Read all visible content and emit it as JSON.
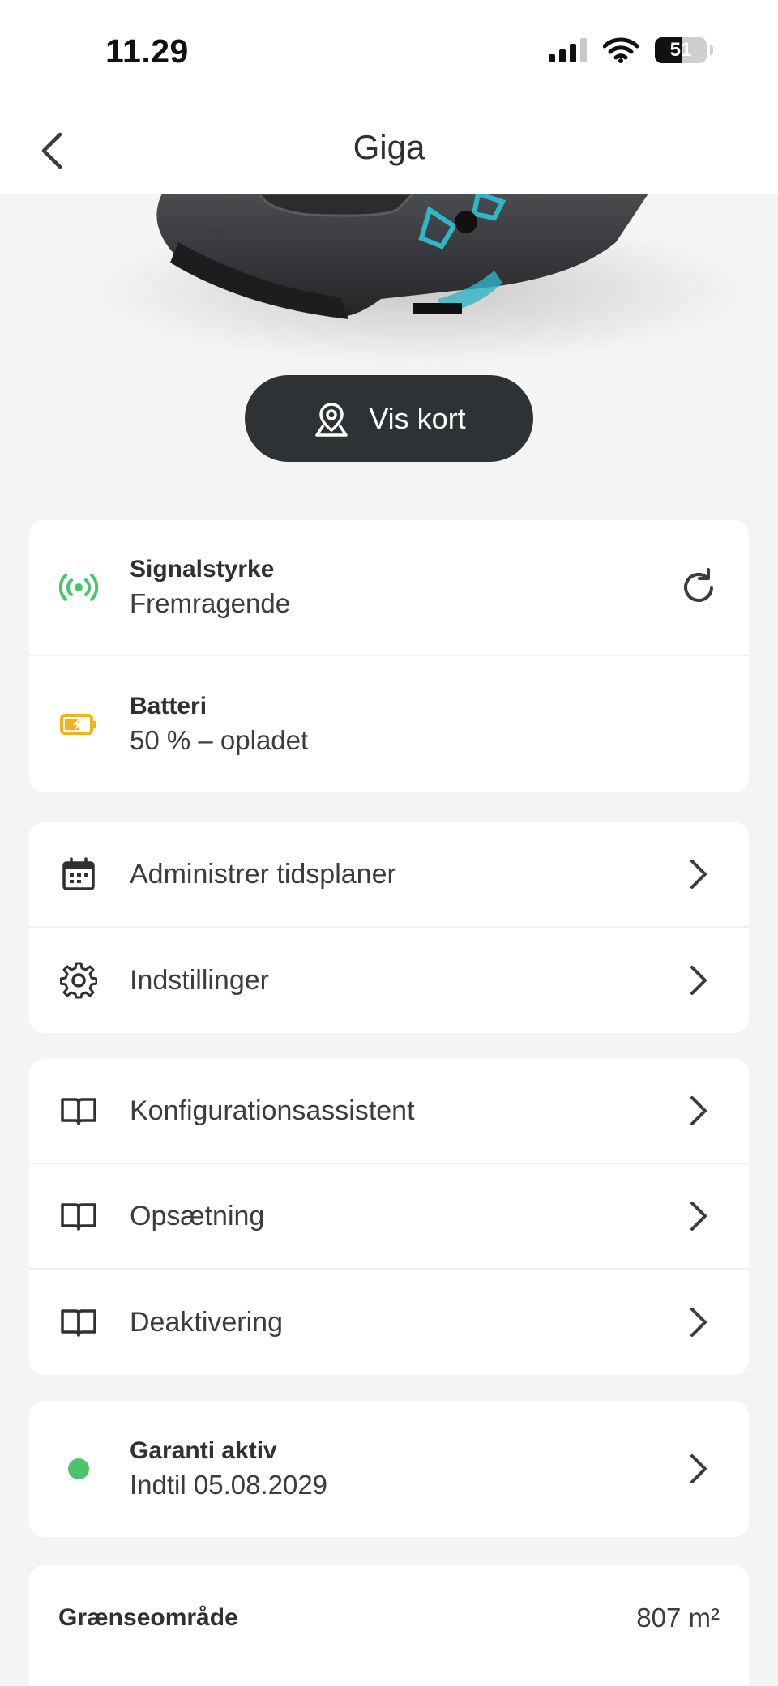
{
  "status_bar": {
    "time": "11.29",
    "battery_level": "51"
  },
  "nav": {
    "title": "Giga"
  },
  "map_button": {
    "label": "Vis kort"
  },
  "status_card": {
    "signal": {
      "title": "Signalstyrke",
      "value": "Fremragende",
      "color": "#4cc46b"
    },
    "battery": {
      "title": "Batteri",
      "value": "50 % – opladet",
      "color": "#f3b21b"
    }
  },
  "menu_card": {
    "items": [
      {
        "label": "Administrer tidsplaner",
        "icon": "calendar-icon"
      },
      {
        "label": "Indstillinger",
        "icon": "gear-icon"
      }
    ]
  },
  "guides_card": {
    "items": [
      {
        "label": "Konfigurationsassistent",
        "icon": "book-icon"
      },
      {
        "label": "Opsætning",
        "icon": "book-icon"
      },
      {
        "label": "Deaktivering",
        "icon": "book-icon"
      }
    ]
  },
  "warranty_card": {
    "title": "Garanti aktiv",
    "value": "Indtil 05.08.2029",
    "color": "#4cc46b"
  },
  "area_card": {
    "label": "Grænseområde",
    "value": "807 m²"
  }
}
